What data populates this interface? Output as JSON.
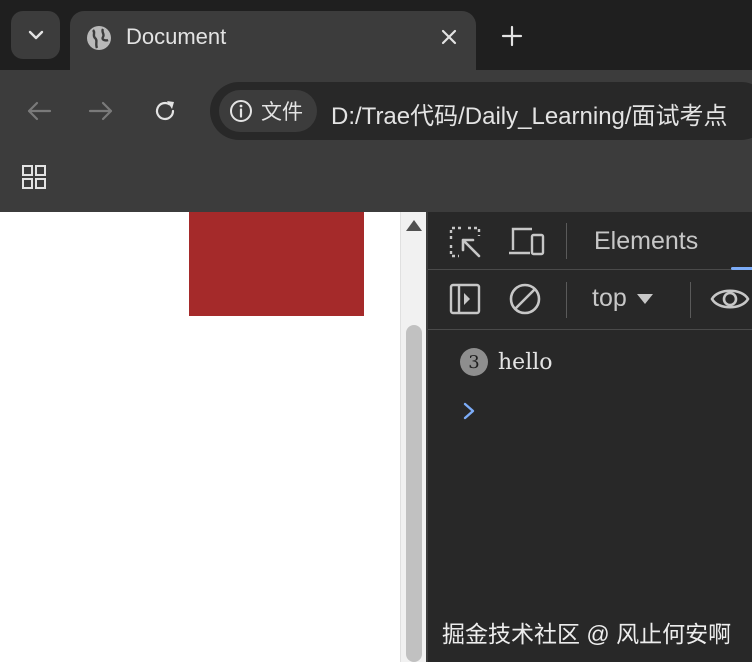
{
  "tab": {
    "title": "Document"
  },
  "omnibox": {
    "chip_label": "文件",
    "url": "D:/Trae代码/Daily_Learning/面试考点"
  },
  "devtools": {
    "tabs": {
      "elements": "Elements"
    },
    "console": {
      "context": "top",
      "messages": [
        {
          "count": "3",
          "text": "hello"
        }
      ]
    }
  },
  "watermark": "掘金技术社区 @ 风止何安啊",
  "colors": {
    "red_box": "#a52a2a",
    "devtools_bg": "#282828",
    "toolbar_bg": "#3c3c3c",
    "accent": "#7cacf8"
  }
}
